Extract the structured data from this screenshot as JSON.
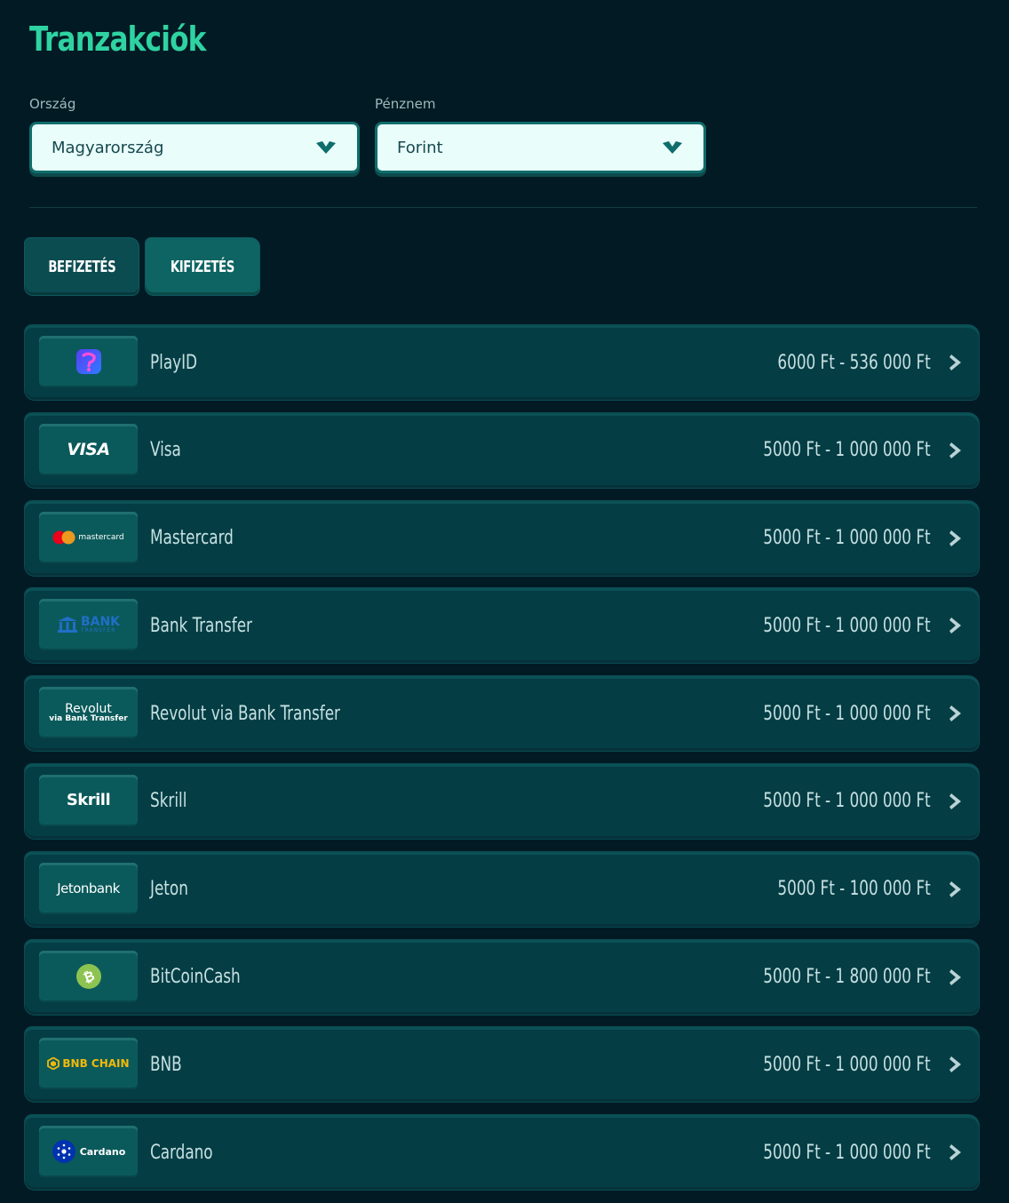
{
  "page": {
    "title": "Tranzakciók"
  },
  "filters": {
    "country": {
      "label": "Ország",
      "value": "Magyarország"
    },
    "currency": {
      "label": "Pénznem",
      "value": "Forint"
    }
  },
  "tabs": [
    {
      "label": "BEFIZETÉS"
    },
    {
      "label": "KIFIZETÉS"
    }
  ],
  "methods": [
    {
      "name": "PlayID",
      "range": "6000 Ft - 536 000 Ft",
      "logo_icon": "playid-logo-icon"
    },
    {
      "name": "Visa",
      "range": "5000 Ft - 1 000 000 Ft",
      "logo_icon": "visa-logo-icon",
      "logo_text": "VISA"
    },
    {
      "name": "Mastercard",
      "range": "5000 Ft - 1 000 000 Ft",
      "logo_icon": "mastercard-logo-icon",
      "logo_text": "mastercard"
    },
    {
      "name": "Bank Transfer",
      "range": "5000 Ft - 1 000 000 Ft",
      "logo_icon": "bank-transfer-logo-icon",
      "logo_text": "BANK",
      "logo_subtext": "TRANSFER"
    },
    {
      "name": "Revolut via Bank Transfer",
      "range": "5000 Ft - 1 000 000 Ft",
      "logo_icon": "revolut-logo-icon",
      "logo_text": "Revolut",
      "logo_subtext": "via Bank Transfer"
    },
    {
      "name": "Skrill",
      "range": "5000 Ft - 1 000 000 Ft",
      "logo_icon": "skrill-logo-icon",
      "logo_text": "Skrill"
    },
    {
      "name": "Jeton",
      "range": "5000 Ft - 100 000 Ft",
      "logo_icon": "jetonbank-logo-icon",
      "logo_text": "Jetonbank"
    },
    {
      "name": "BitCoinCash",
      "range": "5000 Ft - 1 800 000 Ft",
      "logo_icon": "bitcoincash-logo-icon"
    },
    {
      "name": "BNB",
      "range": "5000 Ft - 1 000 000 Ft",
      "logo_icon": "bnb-chain-logo-icon",
      "logo_text": "BNB CHAIN"
    },
    {
      "name": "Cardano",
      "range": "5000 Ft - 1 000 000 Ft",
      "logo_icon": "cardano-logo-icon",
      "logo_text": "Cardano"
    }
  ],
  "colors": {
    "background": "#021a24",
    "accent": "#2fd3a1",
    "row": "#053d45",
    "select_bg": "#e9fdfb"
  }
}
